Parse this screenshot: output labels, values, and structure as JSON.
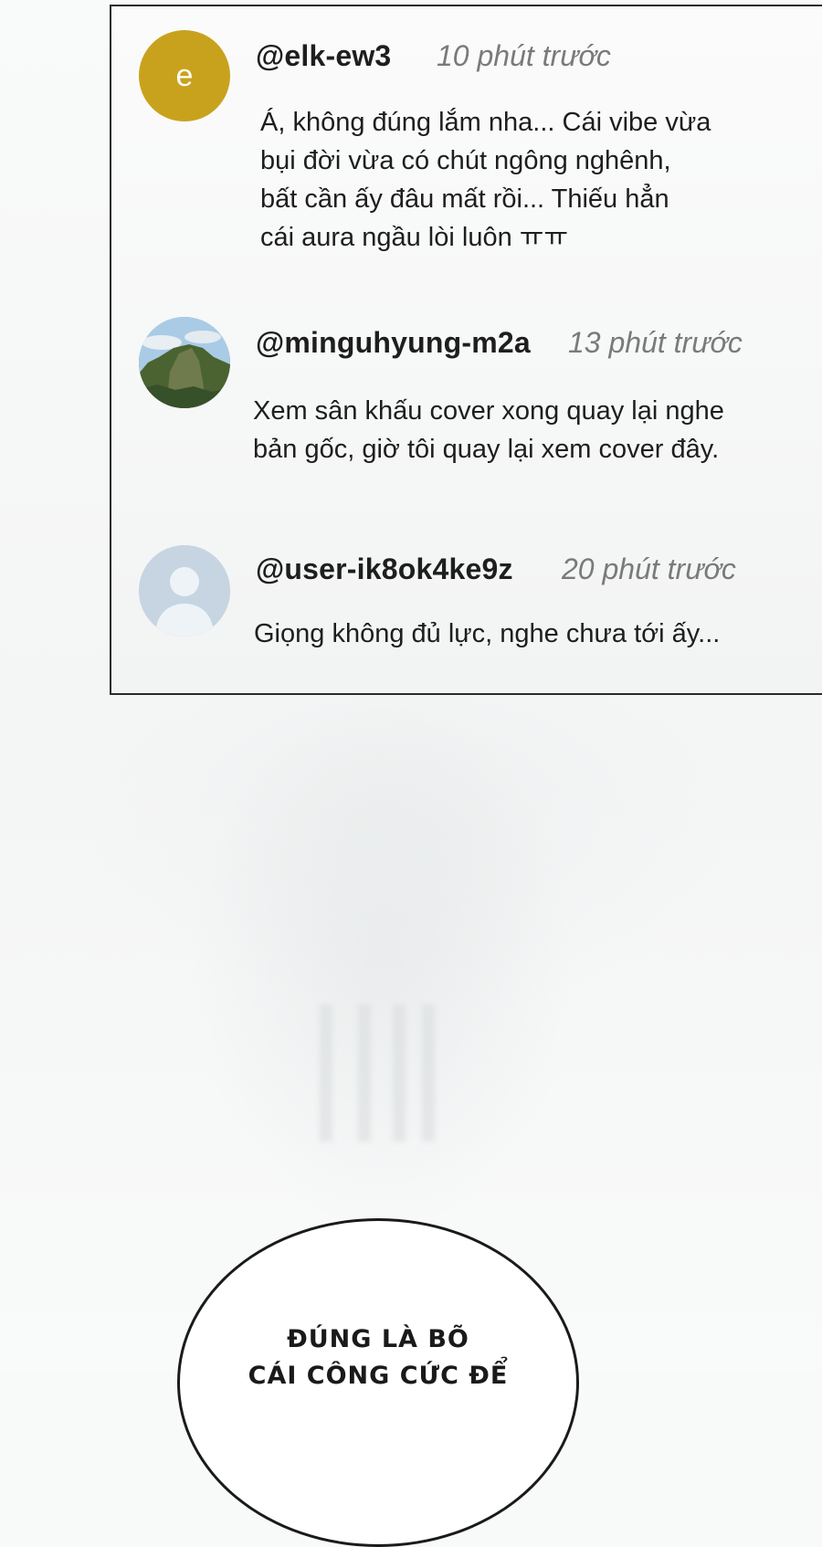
{
  "comments": [
    {
      "avatar_type": "letter",
      "avatar_letter": "e",
      "avatar_color": "#c9a21d",
      "username": "@elk-ew3",
      "timestamp": "10 phút trước",
      "lines": [
        "Á, không đúng lắm nha... Cái vibe vừa",
        "bụi đời vừa có chút ngông nghênh,",
        "bất cần ấy đâu mất rồi... Thiếu hẳn",
        "cái aura ngầu lòi luôn ㅠㅠ"
      ]
    },
    {
      "avatar_type": "landscape-photo",
      "username": "@minguhyung-m2a",
      "timestamp": "13 phút trước",
      "lines": [
        "Xem sân khấu cover xong quay lại nghe",
        "bản gốc, giờ tôi quay lại xem cover đây."
      ]
    },
    {
      "avatar_type": "default-user",
      "username": "@user-ik8ok4ke9z",
      "timestamp": "20 phút trước",
      "lines": [
        "Giọng không đủ lực, nghe chưa tới ấy..."
      ]
    }
  ],
  "speech_bubble": {
    "lines": [
      "ĐÚNG LÀ BÕ",
      "CÁI CÔNG CỨC ĐỂ"
    ]
  }
}
